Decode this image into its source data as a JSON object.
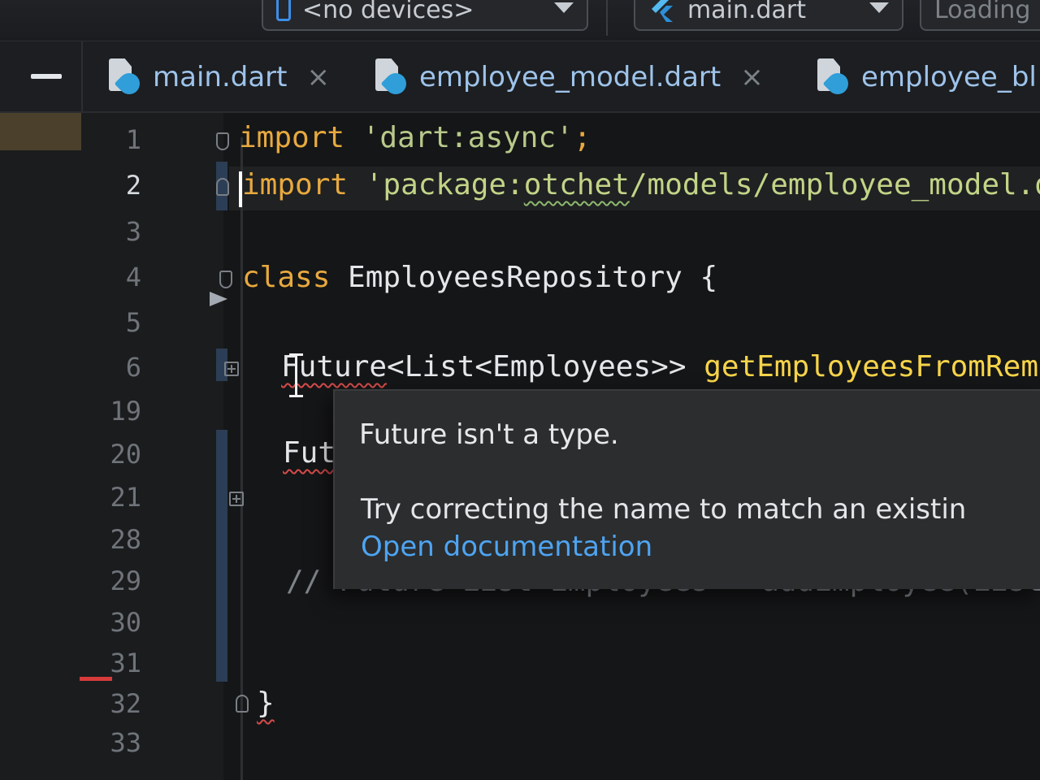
{
  "toolbar": {
    "devices_label": "<no devices>",
    "config_label": "main.dart",
    "loading_label": "Loading"
  },
  "tabs": [
    {
      "label": "main.dart",
      "close": "×"
    },
    {
      "label": "employee_model.dart",
      "close": "×"
    },
    {
      "label": "employee_bl"
    }
  ],
  "editor": {
    "lines": [
      {
        "num": "1"
      },
      {
        "num": "2",
        "active": true
      },
      {
        "num": "3"
      },
      {
        "num": "4"
      },
      {
        "num": "5"
      },
      {
        "num": "6"
      },
      {
        "num": "19"
      },
      {
        "num": "20"
      },
      {
        "num": "21"
      },
      {
        "num": "28"
      },
      {
        "num": "29"
      },
      {
        "num": "30"
      },
      {
        "num": "31"
      },
      {
        "num": "32"
      },
      {
        "num": "33"
      }
    ],
    "code": {
      "l1_kw": "import",
      "l1_str": " 'dart:async'",
      "l1_end": ";",
      "l2_kw": "import",
      "l2_str_a": " 'package:",
      "l2_str_b": "otchet",
      "l2_str_c": "/models/employee_model.d",
      "l4_kw": "class",
      "l4_name": " EmployeesRepository {",
      "l6_future": "Future",
      "l6_type": "<List<Employees>> ",
      "l6_fn": "getEmployeesFromRemo",
      "l20_future": "Fut",
      "l29_comment": "// Future<List<Employees>> addEmployee(List<E",
      "l32_brace": "}"
    }
  },
  "tooltip": {
    "title": "Future isn't a type.",
    "body": "Try correcting the name to match an existin",
    "link": "Open documentation"
  },
  "colors": {
    "keyword": "#e8a93f",
    "string": "#b8c98a",
    "function": "#f6d44a",
    "error_underline": "#d64b4b",
    "link": "#4ea4f2",
    "accent_blue": "#3d8ee8"
  }
}
